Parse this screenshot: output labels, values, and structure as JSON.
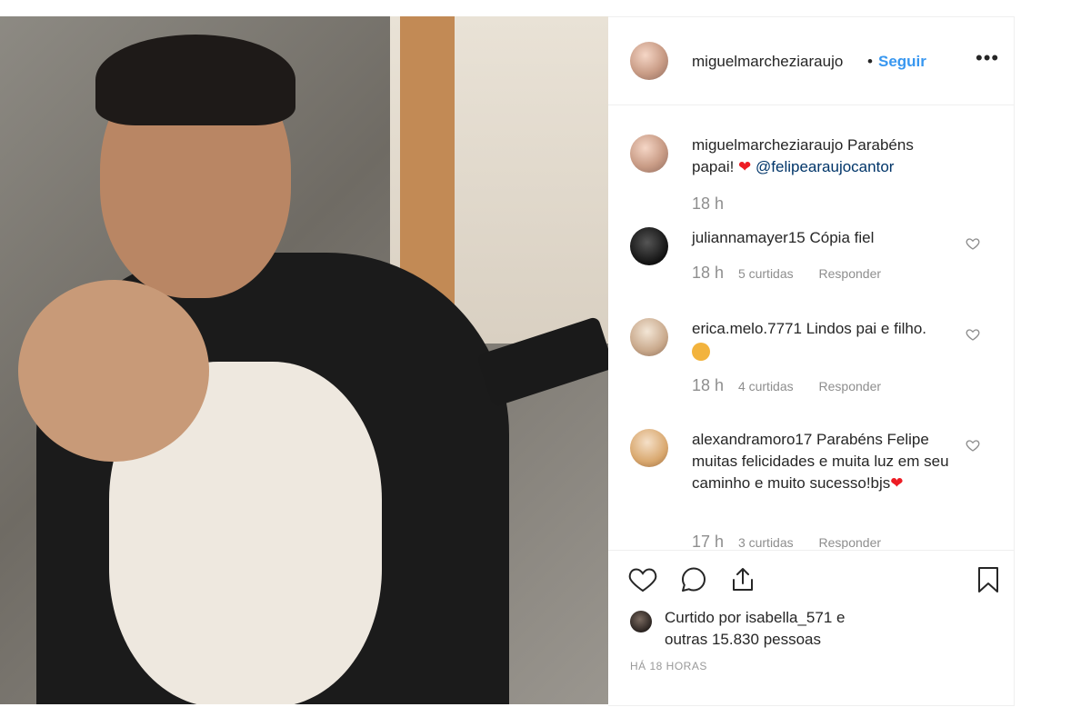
{
  "post": {
    "image_alt": "Foto de um homem segurando um bebê no colo"
  },
  "header": {
    "username": "miguelmarcheziaraujo",
    "separator": "•",
    "follow_label": "Seguir",
    "more_icon": "more-options-icon"
  },
  "comments": [
    {
      "username": "miguelmarcheziaraujo",
      "text": "Parabéns papai! ",
      "emoji": "❤",
      "mention": "@felipearaujocantor",
      "time": "18 h"
    },
    {
      "username": "juliannamayer15",
      "text": "Cópia fiel",
      "time": "18 h",
      "likes": "5 curtidas",
      "reply": "Responder"
    },
    {
      "username": "erica.melo.7771",
      "text": "Lindos pai e filho.",
      "emoji": "👏",
      "time": "18 h",
      "likes": "4 curtidas",
      "reply": "Responder"
    },
    {
      "username": "alexandramoro17",
      "text": "Parabéns Felipe muitas felicidades e muita luz em seu caminho e muito sucesso!bjs",
      "emoji": "❤",
      "time": "17 h",
      "likes": "3 curtidas",
      "reply": "Responder"
    }
  ],
  "actions": {
    "like_icon": "heart-icon",
    "comment_icon": "comment-icon",
    "share_icon": "share-icon",
    "save_icon": "bookmark-icon"
  },
  "likes": {
    "line1_prefix": "Curtido por ",
    "liked_by": "isabella_571",
    "line1_suffix": " e",
    "line2": "outras 15.830 pessoas"
  },
  "timestamp": "HÁ 18 HORAS",
  "colors": {
    "link": "#3897f0",
    "mention": "#003569",
    "heart": "#ed1c24",
    "muted": "#8e8e8e"
  }
}
